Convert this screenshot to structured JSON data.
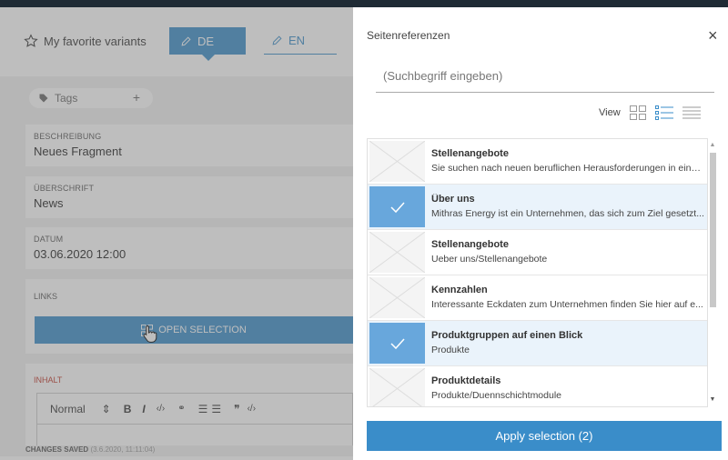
{
  "editor": {
    "favorites_label": "My favorite variants",
    "lang_de": "DE",
    "lang_en": "EN",
    "tags_label": "Tags",
    "tags_add": "+",
    "fields": [
      {
        "label": "BESCHREIBUNG",
        "value": "Neues Fragment"
      },
      {
        "label": "ÜBERSCHRIFT",
        "value": "News"
      },
      {
        "label": "DATUM",
        "value": "03.06.2020 12:00"
      }
    ],
    "links_label": "LINKS",
    "open_selection": "OPEN SELECTION",
    "inhalt_label": "INHALT",
    "toolbar": {
      "format": "Normal",
      "format_arrows": "⇕",
      "bold": "B",
      "italic": "I",
      "code": "‹/›",
      "link": "🔗",
      "ordered_list": "☰",
      "bullet_list": "☰",
      "quote": "❞",
      "code_block": "‹/›"
    },
    "status": "CHANGES SAVED",
    "status_time": "(3.6.2020, 11:11:04)"
  },
  "panel": {
    "title": "Seitenreferenzen",
    "close": "×",
    "search_placeholder": "(Suchbegriff eingeben)",
    "view_label": "View",
    "items": [
      {
        "title": "Stellenangebote",
        "desc": "Sie suchen nach neuen beruflichen Herausforderungen in eine...",
        "selected": false
      },
      {
        "title": "Über uns",
        "desc": "Mithras Energy ist ein Unternehmen, das sich zum Ziel gesetzt...",
        "selected": true
      },
      {
        "title": "Stellenangebote",
        "desc": "Ueber uns/Stellenangebote",
        "selected": false
      },
      {
        "title": "Kennzahlen",
        "desc": "Interessante Eckdaten zum Unternehmen finden Sie hier auf e...",
        "selected": false
      },
      {
        "title": "Produktgruppen auf einen Blick",
        "desc": "Produkte",
        "selected": true
      },
      {
        "title": "Produktdetails",
        "desc": "Produkte/Duennschichtmodule",
        "selected": false
      }
    ],
    "apply_label": "Apply selection (2)",
    "colors": {
      "accent": "#3a8dc9",
      "selected_thumb": "#68a7dc",
      "selected_row": "#eaf3fb"
    }
  }
}
